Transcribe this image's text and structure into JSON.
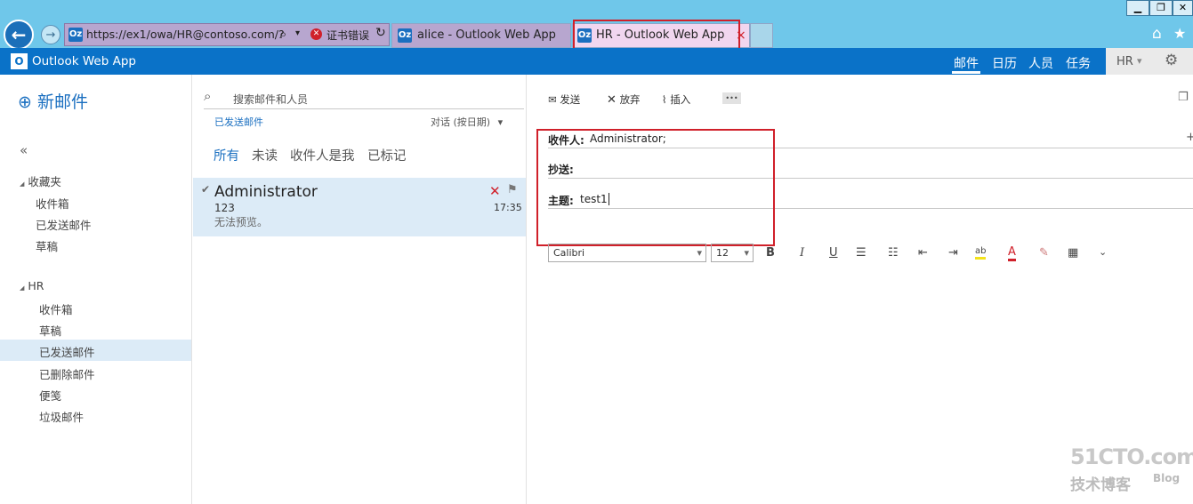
{
  "browser": {
    "address": "https://ex1/owa/HR@contoso.com/?",
    "cert_error": "证书错误",
    "tabs": [
      {
        "title": "alice - Outlook Web App",
        "favicon": "Oz"
      },
      {
        "title": "HR - Outlook Web App",
        "favicon": "Oz"
      }
    ],
    "favicon_address": "Oz",
    "min_glyph": "▁",
    "restore_glyph": "❐",
    "back_glyph": "←",
    "forward_glyph": "→",
    "search_glyph": "⌕",
    "dropdown_glyph": "▾",
    "refresh_glyph": "↻",
    "home_glyph": "⌂",
    "star_glyph": "★",
    "settings_glyph": "⚙",
    "cert_glyph": "✕",
    "tab_close_glyph": "×",
    "colors": {
      "chrome": "#6fc7ea",
      "address_bg": "#b7a6cf",
      "tab_alice": "#b7a6cf",
      "tab_hr": "#f1d6ef"
    }
  },
  "owa": {
    "logo_text": "Outlook Web App",
    "logo_badge": "O",
    "nav": [
      "邮件",
      "日历",
      "人员",
      "任务"
    ],
    "user": "HR",
    "user_glyph": "▾",
    "settings_glyph": "⚙",
    "brand_color": "#0a72c8"
  },
  "leftpane": {
    "new_mail": "新邮件",
    "new_mail_glyph": "⊕",
    "collapse_glyph": "«",
    "favorites_header": "收藏夹",
    "favorites": [
      "收件箱",
      "已发送邮件",
      "草稿"
    ],
    "account_header": "HR",
    "account_folders": [
      "收件箱",
      "草稿",
      "已发送邮件",
      "已删除邮件",
      "便笺",
      "垃圾邮件"
    ],
    "selected_folder": "已发送邮件",
    "caret_glyph": "◢"
  },
  "midpane": {
    "search_placeholder": "搜索邮件和人员",
    "search_glyph": "⌕",
    "folder_name": "已发送邮件",
    "sort_label": "对话 (按日期)",
    "sort_glyph": "▾",
    "filters": [
      "所有",
      "未读",
      "收件人是我",
      "已标记"
    ],
    "message": {
      "sender": "Administrator",
      "subject": "123",
      "preview": "无法预览。",
      "time": "17:35",
      "check_glyph": "✔",
      "delete_glyph": "✕",
      "flag_glyph": "⚑"
    }
  },
  "compose": {
    "toolbar": {
      "send": "发送",
      "discard": "放弃",
      "insert": "插入",
      "more": "•••",
      "send_glyph": "✉",
      "discard_glyph": "✕",
      "insert_glyph": "⌇",
      "popout_glyph": "❐"
    },
    "to_label": "收件人:",
    "to_value": "Administrator;",
    "cc_label": "抄送:",
    "subject_label": "主题:",
    "subject_value": "test1",
    "plus_glyph": "+",
    "font_name": "Calibri",
    "font_size": "12",
    "select_glyph": "▾",
    "format_buttons": [
      "B",
      "I",
      "U",
      "☰",
      "☷",
      "⇤",
      "⇥",
      "ab",
      "A",
      "✎",
      "▦",
      "⌄"
    ]
  },
  "watermark": {
    "site": "51CTO.com",
    "sub": "技术博客",
    "blog": "Blog"
  }
}
